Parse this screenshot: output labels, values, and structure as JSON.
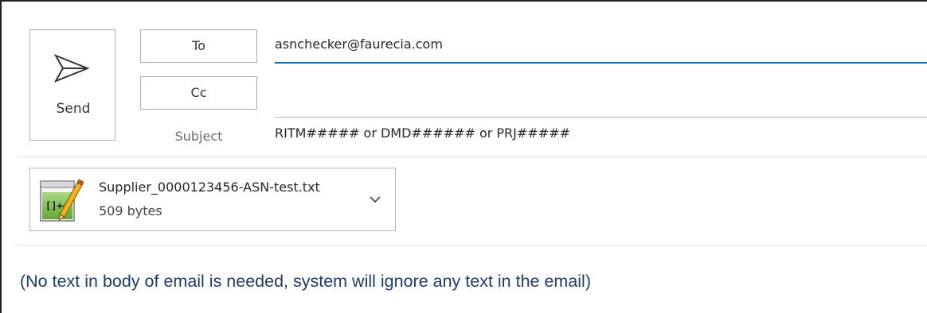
{
  "compose": {
    "send_label": "Send",
    "to_label": "To",
    "cc_label": "Cc",
    "subject_label": "Subject",
    "to_value": "asnchecker@faurecia.com",
    "cc_value": "",
    "subject_value": "RITM##### or DMD###### or PRJ#####"
  },
  "attachment": {
    "file_name": "Supplier_0000123456-ASN-test.txt",
    "file_size": "509 bytes",
    "icon": "notepad-plus-plus-file-icon"
  },
  "body": {
    "text": "(No text in body of email is needed, system will ignore any text in the email)"
  },
  "colors": {
    "accent": "#0a6cc2",
    "body_text": "#1f3a6b",
    "border": "#ababab"
  }
}
